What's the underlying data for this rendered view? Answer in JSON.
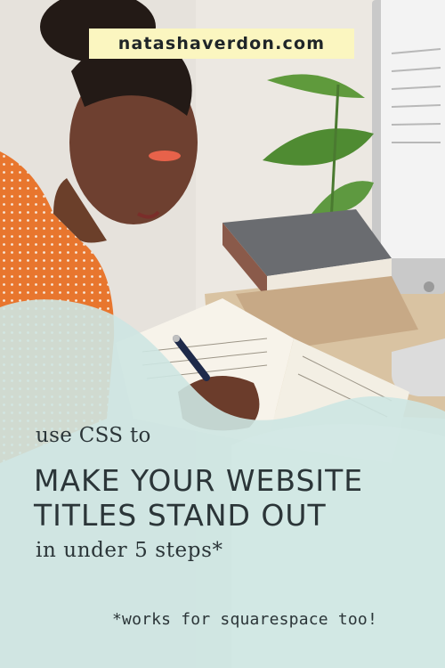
{
  "badge": {
    "site": "natashaverdon.com"
  },
  "heading": {
    "pre": "use CSS to",
    "line1": "MAKE YOUR WEBSITE",
    "line2": "TITLES STAND OUT",
    "post": "in under 5 steps*"
  },
  "footnote": "*works for squarespace too!",
  "colors": {
    "overlay": "#cfe6e3",
    "badge": "#fbf6c0",
    "text": "#2b3538"
  }
}
